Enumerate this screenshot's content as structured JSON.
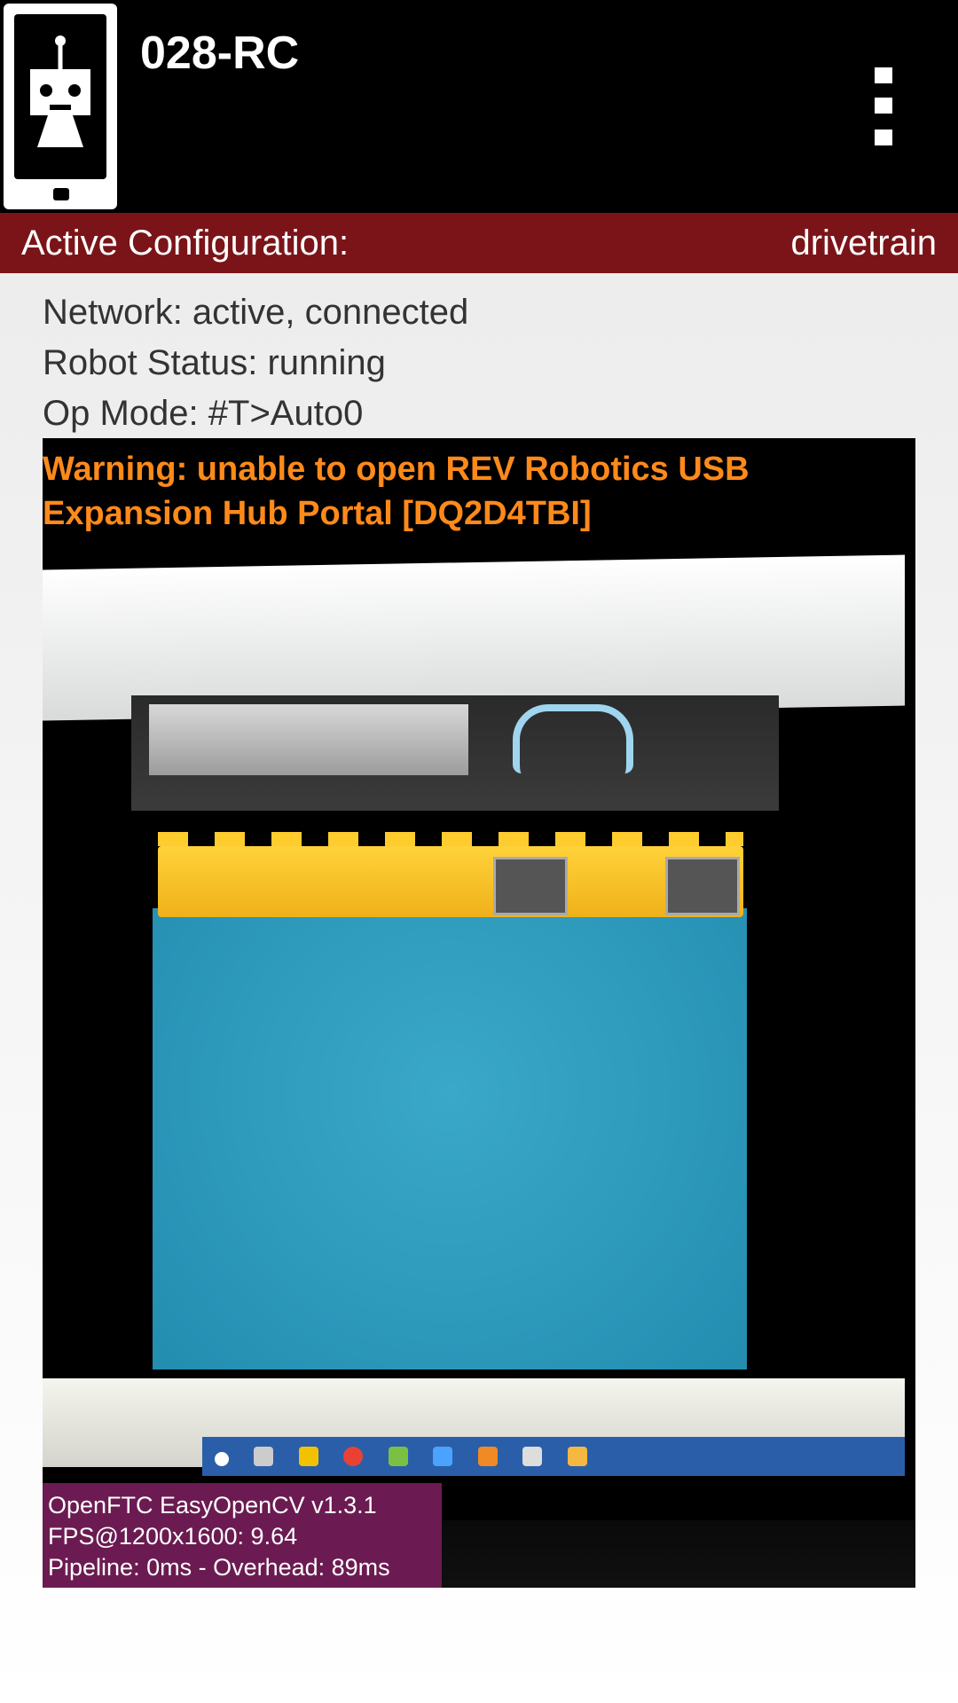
{
  "appbar": {
    "title": "028-RC",
    "menu_icon": "overflow-menu-icon",
    "app_icon": "robot-phone-icon"
  },
  "config": {
    "label": "Active Configuration:",
    "value": "drivetrain"
  },
  "status": {
    "network": "Network: active, connected",
    "robot": "Robot Status: running",
    "op_mode": "Op Mode: #T>Auto0"
  },
  "camera": {
    "warning": "Warning: unable to open REV Robotics USB Expansion Hub Portal [DQ2D4TBI]",
    "overlay": {
      "line1": "OpenFTC EasyOpenCV v1.3.1",
      "line2": "FPS@1200x1600: 9.64",
      "line3": "Pipeline: 0ms - Overhead: 89ms"
    }
  },
  "colors": {
    "appbar_bg": "#000000",
    "config_bar": "#7b1418",
    "warning_text": "#ff8a1a",
    "overlay_bg": "#6b1b52"
  }
}
